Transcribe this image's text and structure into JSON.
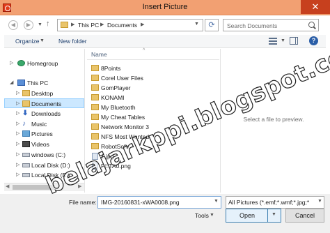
{
  "window": {
    "title": "Insert Picture",
    "close_glyph": "✕"
  },
  "address": {
    "crumbs": [
      "This PC",
      "Documents"
    ],
    "search_placeholder": "Search Documents"
  },
  "toolbar": {
    "organize_label": "Organize",
    "new_folder_label": "New folder",
    "help_glyph": "?"
  },
  "nav": {
    "items": [
      {
        "label": "Homegroup",
        "icon": "homegroup-icon"
      },
      {
        "label": "This PC",
        "icon": "computer-icon"
      },
      {
        "label": "Desktop",
        "icon": "folder-icon"
      },
      {
        "label": "Documents",
        "icon": "folder-icon"
      },
      {
        "label": "Downloads",
        "icon": "downloads-icon"
      },
      {
        "label": "Music",
        "icon": "music-icon"
      },
      {
        "label": "Pictures",
        "icon": "pictures-icon"
      },
      {
        "label": "Videos",
        "icon": "videos-icon"
      },
      {
        "label": "windows (C:)",
        "icon": "drive-icon"
      },
      {
        "label": "Local Disk (D:)",
        "icon": "drive-icon"
      },
      {
        "label": "Local Disk (E:)",
        "icon": "drive-icon"
      }
    ],
    "selected": "Documents"
  },
  "files": {
    "column_name": "Name",
    "items": [
      {
        "label": "8Points",
        "type": "folder"
      },
      {
        "label": "Corel User Files",
        "type": "folder"
      },
      {
        "label": "GomPlayer",
        "type": "folder"
      },
      {
        "label": "KONAMI",
        "type": "folder"
      },
      {
        "label": "My Bluetooth",
        "type": "folder"
      },
      {
        "label": "My Cheat Tables",
        "type": "folder"
      },
      {
        "label": "Network Monitor 3",
        "type": "folder"
      },
      {
        "label": "NFS Most Wanted",
        "type": "folder"
      },
      {
        "label": "RobotSoft",
        "type": "folder"
      },
      {
        "label": "1.jpg",
        "type": "image"
      },
      {
        "label": "PETA0.png",
        "type": "image"
      }
    ]
  },
  "preview": {
    "message": "Select a file to preview."
  },
  "bottom": {
    "file_name_label": "File name:",
    "file_name_value": "IMG-20160831-xWA0008.png",
    "file_type_value": "All Pictures (*.emf;*.wmf;*.jpg;*",
    "tools_label": "Tools",
    "open_label": "Open",
    "cancel_label": "Cancel"
  },
  "watermark": "belajarkppi.blogspot.co.id",
  "colors": {
    "titlebar": "#f2a072",
    "close": "#c7401e",
    "selection": "#cce8ff",
    "folder": "#e9c46a"
  }
}
